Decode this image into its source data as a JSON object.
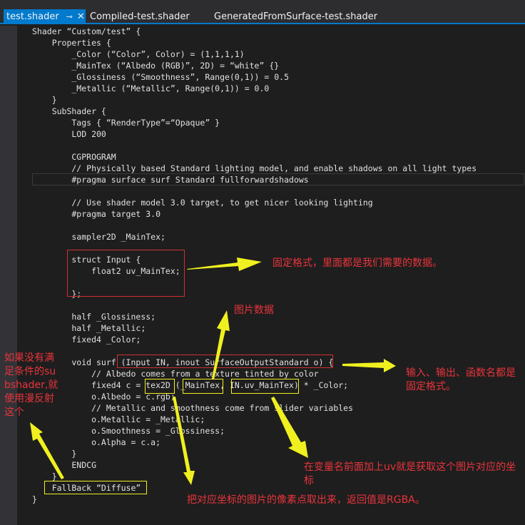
{
  "tabs": [
    {
      "label": "test.shader",
      "active": true,
      "pin_icon": "pin-icon",
      "close_icon": "close-icon"
    },
    {
      "label": "Compiled-test.shader"
    },
    {
      "label": "GeneratedFromSurface-test.shader"
    }
  ],
  "code": [
    "Shader “Custom/test” {",
    "    Properties {",
    "        _Color (“Color”, Color) = (1,1,1,1)",
    "        _MainTex (“Albedo (RGB)”, 2D) = “white” {}",
    "        _Glossiness (“Smoothness”, Range(0,1)) = 0.5",
    "        _Metallic (“Metallic”, Range(0,1)) = 0.0",
    "    }",
    "    SubShader {",
    "        Tags { “RenderType”=“Opaque” }",
    "        LOD 200",
    "",
    "        CGPROGRAM",
    "        // Physically based Standard lighting model, and enable shadows on all light types",
    "        #pragma surface surf Standard fullforwardshadows",
    "",
    "        // Use shader model 3.0 target, to get nicer looking lighting",
    "        #pragma target 3.0",
    "",
    "        sampler2D _MainTex;",
    "",
    "        struct Input {",
    "            float2 uv_MainTex;",
    "",
    "        };",
    "",
    "        half _Glossiness;",
    "        half _Metallic;",
    "        fixed4 _Color;",
    "",
    "        void surf (Input IN, inout SurfaceOutputStandard o) {",
    "            // Albedo comes from a texture tinted by color",
    "            fixed4 c = tex2D (_MainTex, IN.uv_MainTex) * _Color;",
    "            o.Albedo = c.rgb;",
    "            // Metallic and smoothness come from slider variables",
    "            o.Metallic = _Metallic;",
    "            o.Smoothness = _Glossiness;",
    "            o.Alpha = c.a;",
    "        }",
    "        ENDCG",
    "    }",
    "    FallBack “Diffuse”",
    "}"
  ],
  "annotations": {
    "struct_note": "固定格式，里面都是我们需要的数据。",
    "image_data_note": "图片数据",
    "surf_note": "输入、输出、函数名都是固定格式。",
    "fallback_note": "如果没有满足条件的subshader,就使用漫反射这个",
    "uv_note": "在变量名前面加上uv就是获取这个图片对应的坐标",
    "tex2d_note": "把对应坐标的图片的像素点取出来，返回值是RGBA。"
  },
  "colors": {
    "accent": "#007acc",
    "annotation_text": "#e8343c",
    "arrow": "#f0f020",
    "box_red": "#d03030"
  }
}
